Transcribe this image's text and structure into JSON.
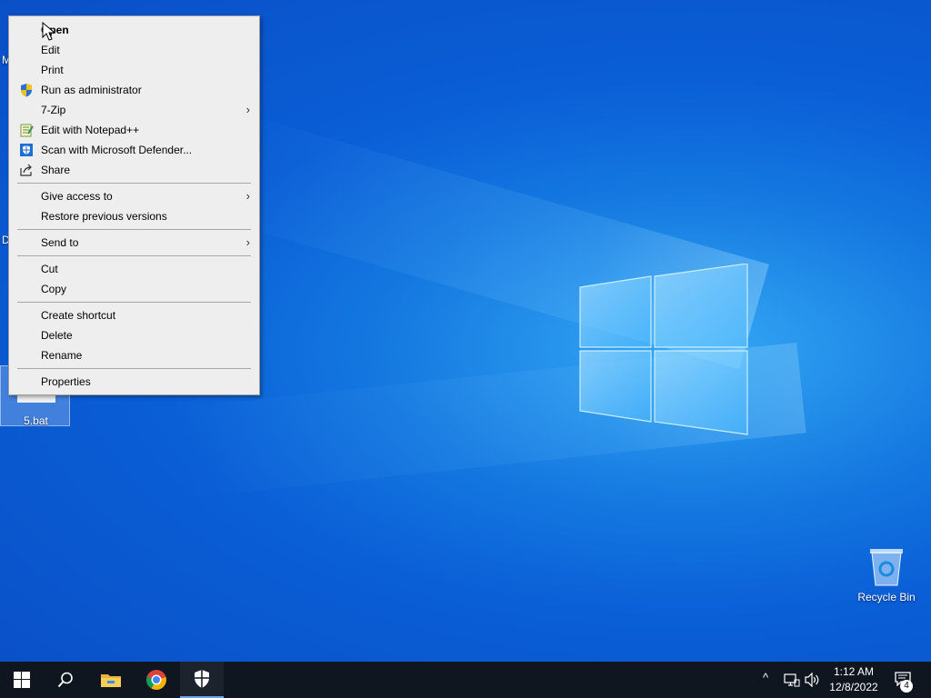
{
  "desktop": {
    "icons": {
      "bat_label": "5.bat",
      "recycle_label": "Recycle Bin",
      "peek_label_1": "M",
      "peek_label_2": "D"
    }
  },
  "context_menu": {
    "items": [
      {
        "label": "Open",
        "icon": "none",
        "bold": true
      },
      {
        "label": "Edit"
      },
      {
        "label": "Print"
      },
      {
        "label": "Run as administrator",
        "icon": "uac-shield-icon"
      },
      {
        "label": "7-Zip",
        "submenu": true
      },
      {
        "label": "Edit with Notepad++",
        "icon": "notepadpp-icon"
      },
      {
        "label": "Scan with Microsoft Defender...",
        "icon": "defender-icon"
      },
      {
        "label": "Share",
        "icon": "share-icon"
      },
      {
        "label": "Give access to",
        "submenu": true
      },
      {
        "label": "Restore previous versions"
      },
      {
        "label": "Send to",
        "submenu": true
      },
      {
        "label": "Cut"
      },
      {
        "label": "Copy"
      },
      {
        "label": "Create shortcut"
      },
      {
        "label": "Delete"
      },
      {
        "label": "Rename"
      },
      {
        "label": "Properties"
      }
    ],
    "submenu_arrow": "›"
  },
  "taskbar": {
    "buttons": [
      "start-icon",
      "search-icon",
      "file-explorer-icon",
      "chrome-icon",
      "security-icon"
    ],
    "tray": {
      "chevron": "^",
      "time": "1:12 AM",
      "date": "12/8/2022",
      "notification_count": "4"
    }
  },
  "colors": {
    "desktop_blue": "#0a5ed6",
    "taskbar": "#0f1620",
    "menu_bg": "#eeeeee",
    "accent": "#6aa6e8"
  }
}
